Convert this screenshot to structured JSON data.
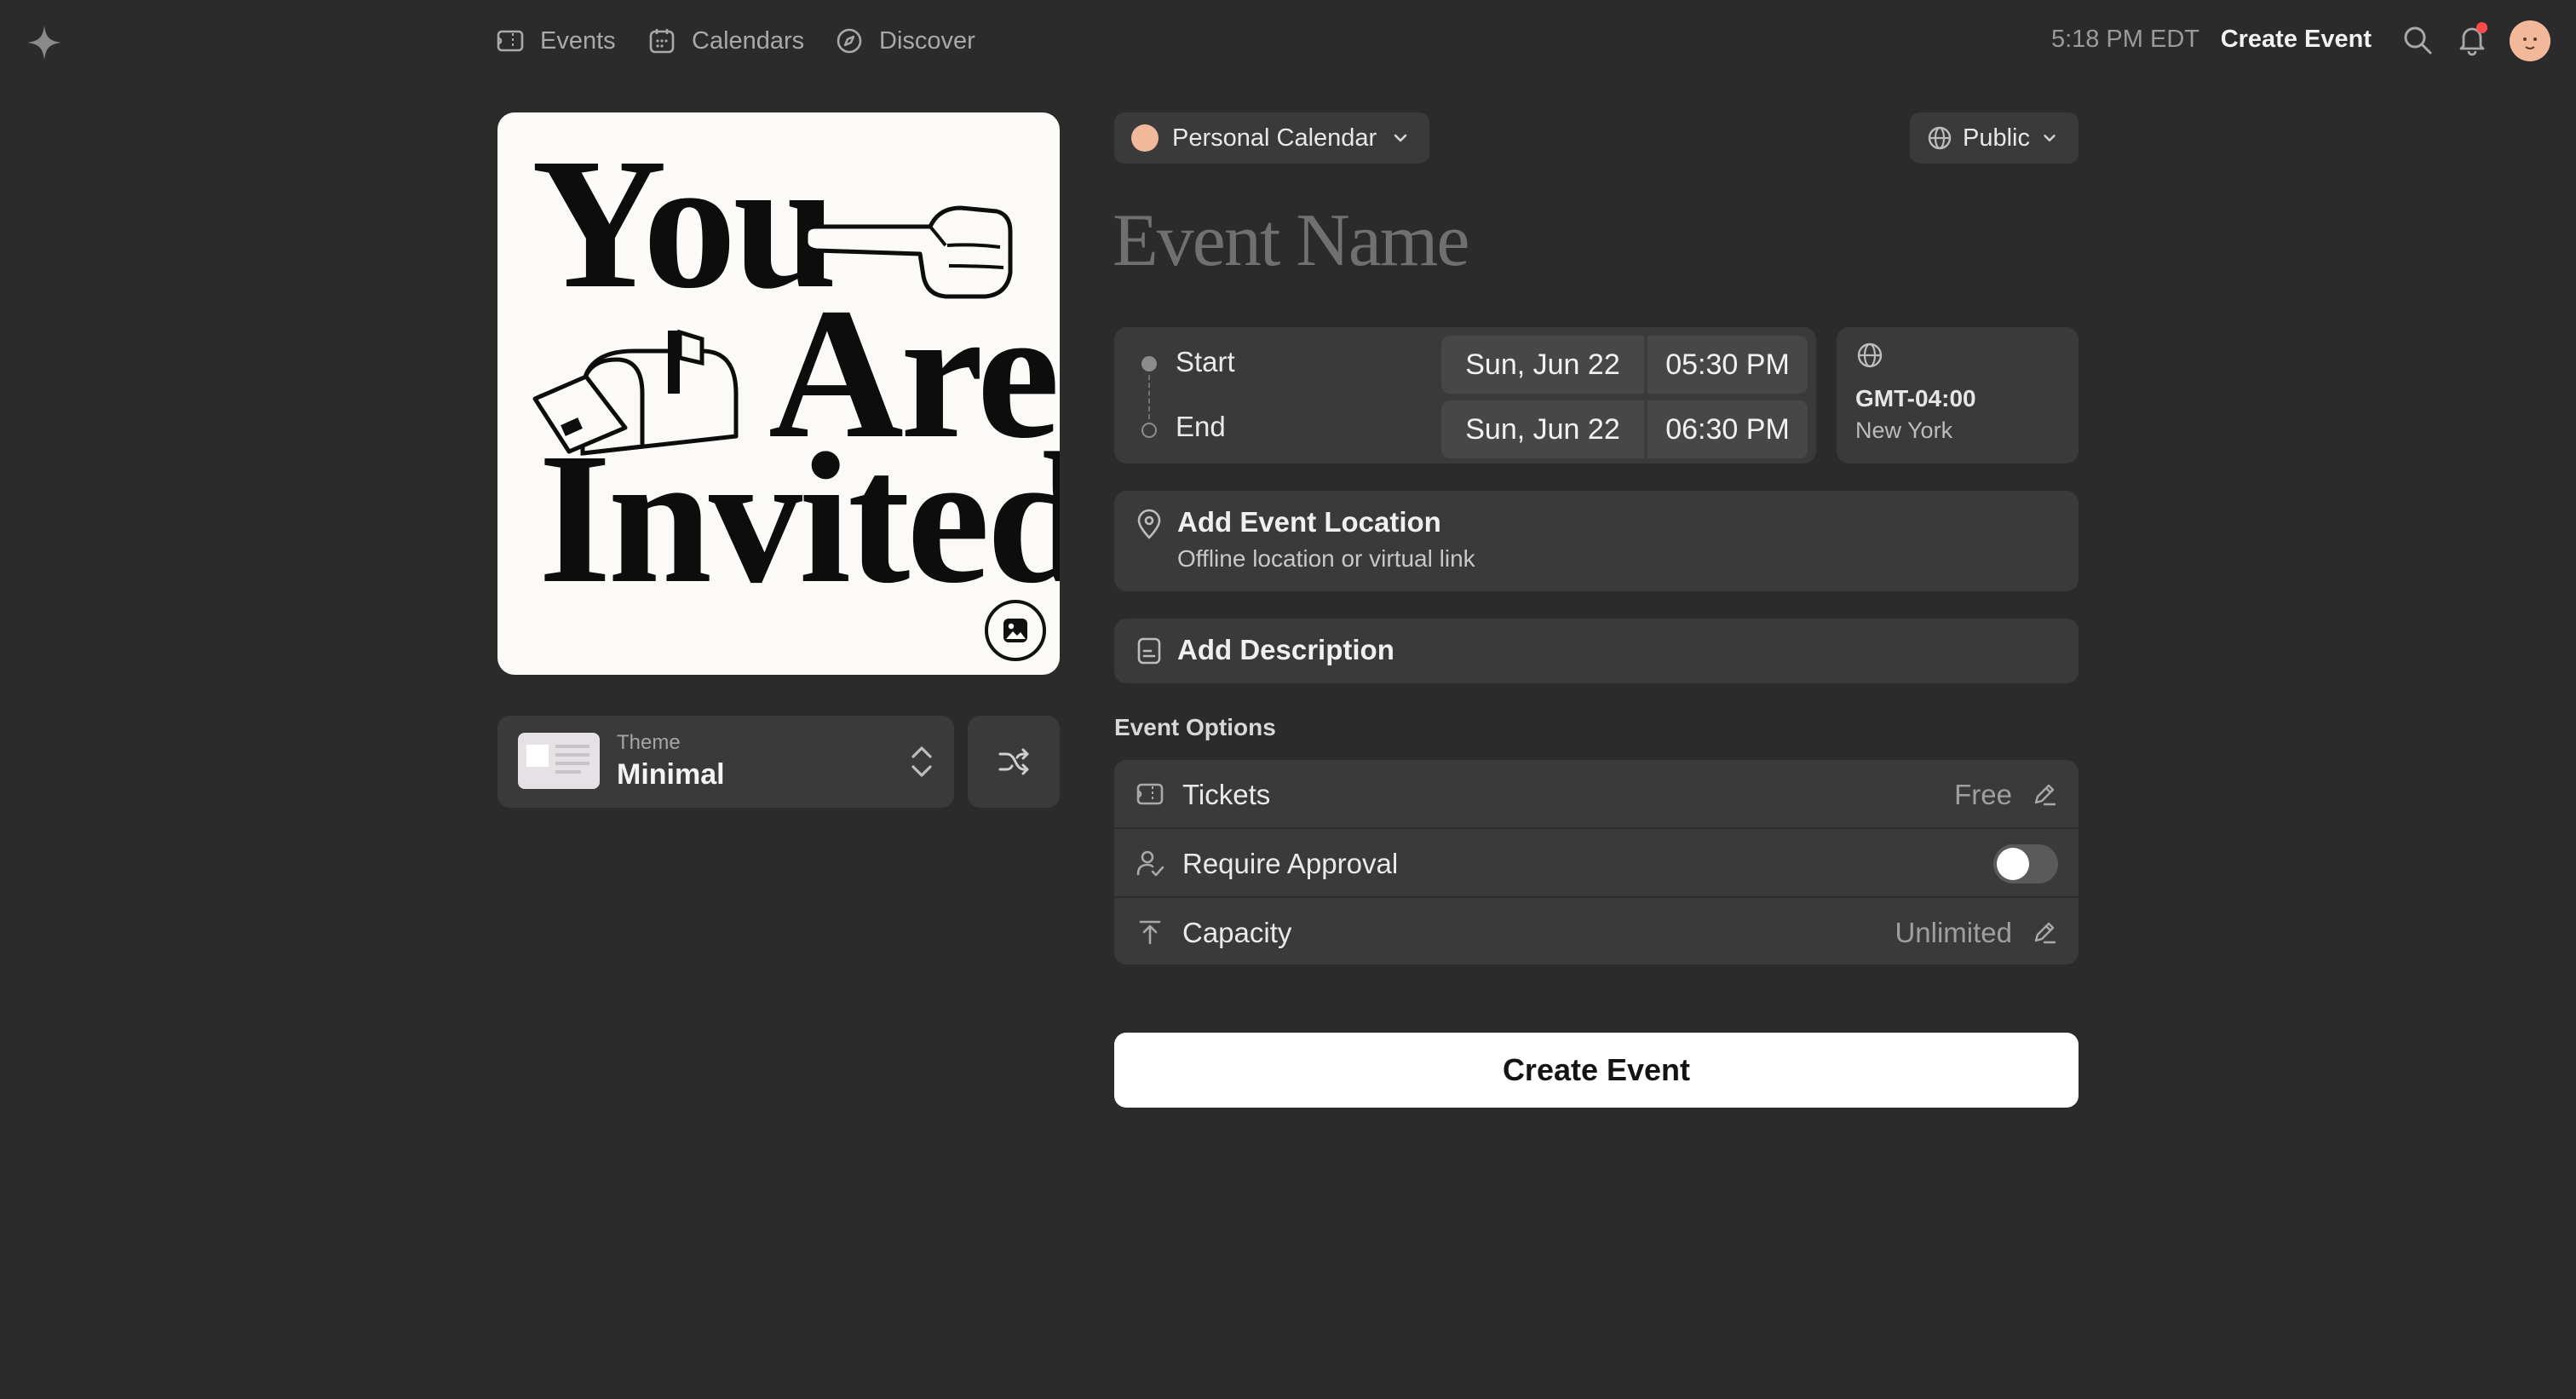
{
  "nav": {
    "items": [
      {
        "label": "Events",
        "icon": "ticket-icon"
      },
      {
        "label": "Calendars",
        "icon": "calendar-icon"
      },
      {
        "label": "Discover",
        "icon": "compass-icon"
      }
    ],
    "time": "5:18 PM EDT",
    "create_label": "Create Event"
  },
  "cover": {
    "line1": "You",
    "line2": "Are",
    "line3": "Invited"
  },
  "theme": {
    "small_label": "Theme",
    "name": "Minimal"
  },
  "calendar_select": {
    "label": "Personal Calendar"
  },
  "visibility": {
    "label": "Public"
  },
  "event_name_placeholder": "Event Name",
  "datetime": {
    "start_label": "Start",
    "start_date": "Sun, Jun 22",
    "start_time": "05:30 PM",
    "end_label": "End",
    "end_date": "Sun, Jun 22",
    "end_time": "06:30 PM"
  },
  "timezone": {
    "offset": "GMT-04:00",
    "city": "New York"
  },
  "location": {
    "title": "Add Event Location",
    "subtitle": "Offline location or virtual link"
  },
  "description": {
    "title": "Add Description"
  },
  "options": {
    "title": "Event Options",
    "tickets_label": "Tickets",
    "tickets_value": "Free",
    "approval_label": "Require Approval",
    "approval_on": false,
    "capacity_label": "Capacity",
    "capacity_value": "Unlimited"
  },
  "submit_label": "Create Event",
  "colors": {
    "background": "#2b2b2b",
    "card": "#3a3a3a",
    "notification_dot": "#ff4b4b",
    "primary_button": "#ffffff"
  }
}
